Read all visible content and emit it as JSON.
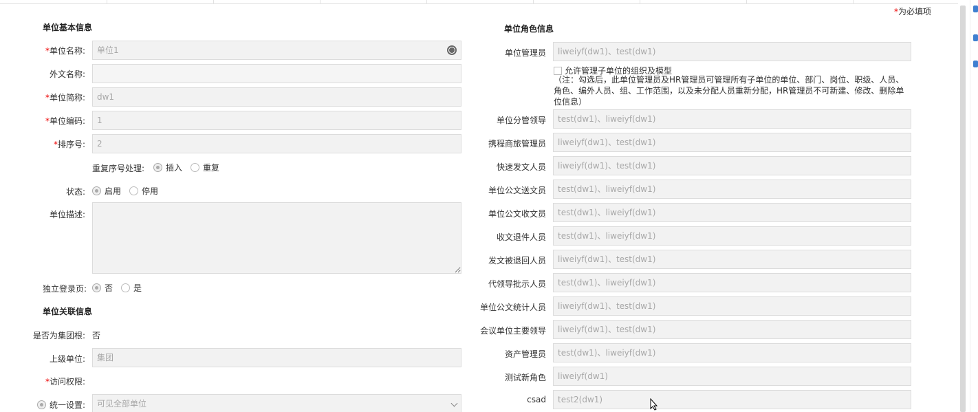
{
  "required_note": "为必填项",
  "sections": {
    "basic": "单位基本信息",
    "relation": "单位关联信息",
    "roles": "单位角色信息"
  },
  "basic": {
    "name_label": "单位名称:",
    "name_value": "单位1",
    "foreign_label": "外文名称:",
    "foreign_value": "",
    "short_label": "单位简称:",
    "short_value": "dw1",
    "code_label": "单位编码:",
    "code_value": "1",
    "order_label": "排序号:",
    "order_value": "2",
    "dup_label": "重复序号处理:",
    "dup_insert": "插入",
    "dup_repeat": "重复",
    "status_label": "状态:",
    "status_on": "启用",
    "status_off": "停用",
    "desc_label": "单位描述:",
    "desc_value": "",
    "login_label": "独立登录页:",
    "login_no": "否",
    "login_yes": "是"
  },
  "relation": {
    "root_label": "是否为集团根:",
    "root_value": "否",
    "parent_label": "上级单位:",
    "parent_value": "集团",
    "access_label": "访问权限:",
    "unified_label": "统一设置:",
    "unified_value": "可见全部单位"
  },
  "roles": {
    "admin_label": "单位管理员",
    "admin_value": "liweiyf(dw1)、test(dw1)",
    "allow_sub_label": "允许管理子单位的组织及模型",
    "allow_note": "（注：勾选后，此单位管理员及HR管理员可管理所有子单位的单位、部门、岗位、职级、人员、角色、编外人员、组、工作范围，以及未分配人员重新分配，HR管理员不可新建、修改、删除单位信息）",
    "items": [
      {
        "label": "单位分管领导",
        "value": "test(dw1)、liweiyf(dw1)"
      },
      {
        "label": "携程商旅管理员",
        "value": "liweiyf(dw1)、test(dw1)"
      },
      {
        "label": "快速发文人员",
        "value": "liweiyf(dw1)、test(dw1)"
      },
      {
        "label": "单位公文送文员",
        "value": "test(dw1)、liweiyf(dw1)"
      },
      {
        "label": "单位公文收文员",
        "value": "test(dw1)、liweiyf(dw1)"
      },
      {
        "label": "收文退件人员",
        "value": "test(dw1)、liweiyf(dw1)"
      },
      {
        "label": "发文被退回人员",
        "value": "liweiyf(dw1)、test(dw1)"
      },
      {
        "label": "代领导批示人员",
        "value": "test(dw1)、liweiyf(dw1)"
      },
      {
        "label": "单位公文统计人员",
        "value": "liweiyf(dw1)、test(dw1)"
      },
      {
        "label": "会议单位主要领导",
        "value": "liweiyf(dw1)、test(dw1)"
      },
      {
        "label": "资产管理员",
        "value": "test(dw1)、liweiyf(dw1)"
      },
      {
        "label": "测试新角色",
        "value": "liweiyf(dw1)"
      },
      {
        "label": "csad",
        "value": "test2(dw1)"
      }
    ]
  }
}
